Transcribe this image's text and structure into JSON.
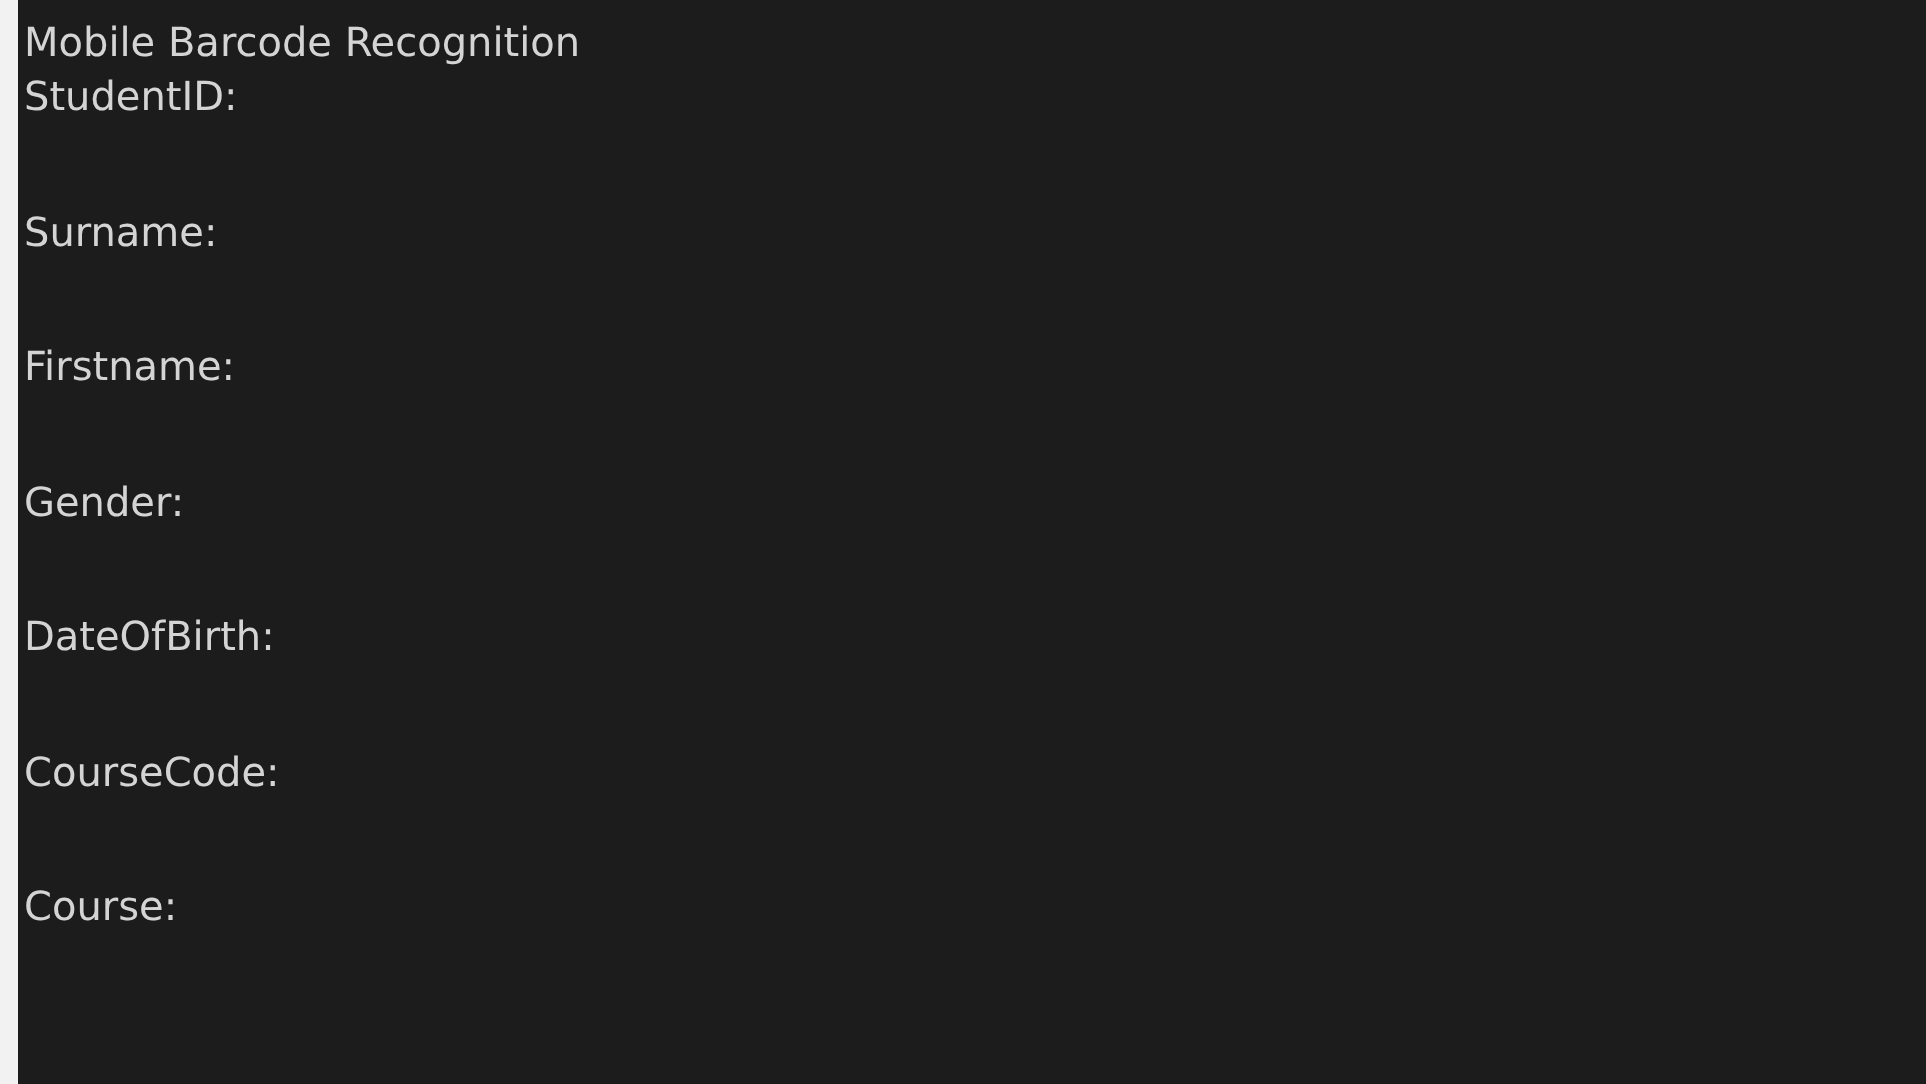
{
  "window": {
    "title": "Mobile Barcode Recognition"
  },
  "fields": [
    {
      "label": "StudentID:"
    },
    {
      "label": "Surname:"
    },
    {
      "label": "Firstname:"
    },
    {
      "label": "Gender:"
    },
    {
      "label": "DateOfBirth:"
    },
    {
      "label": "CourseCode:"
    },
    {
      "label": "Course:"
    }
  ]
}
